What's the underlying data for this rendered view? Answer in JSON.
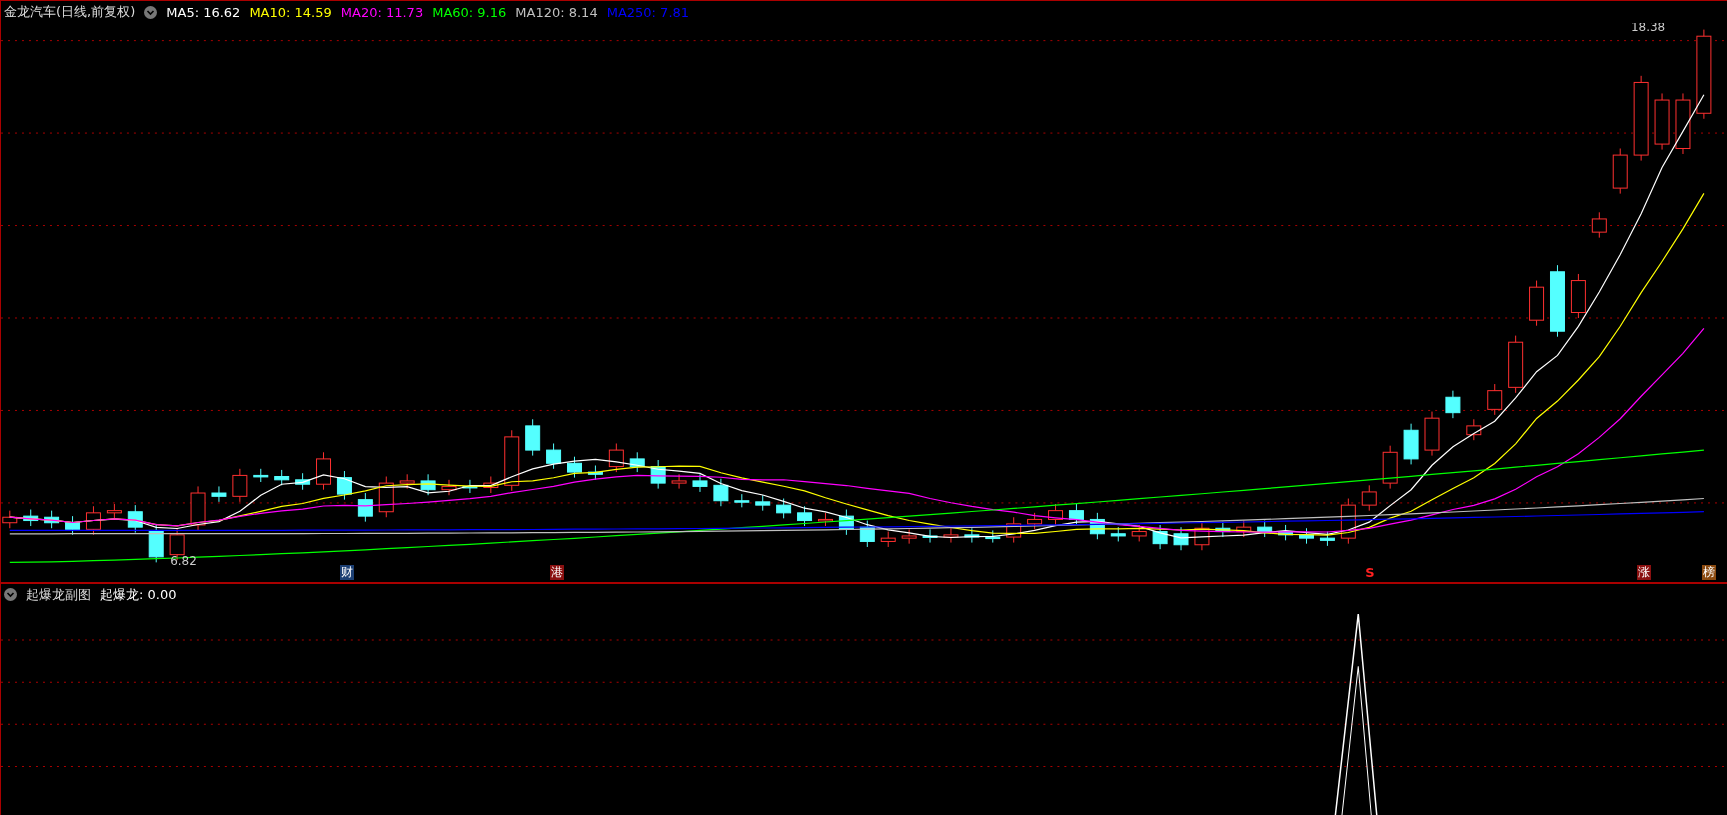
{
  "main_chart": {
    "title": "金龙汽车(日线,前复权)",
    "indicators": [
      {
        "label": "MA5: 16.62",
        "color": "#ffffff"
      },
      {
        "label": "MA10: 14.59",
        "color": "#ffff00"
      },
      {
        "label": "MA20: 11.73",
        "color": "#ff00ff"
      },
      {
        "label": "MA60: 9.16",
        "color": "#00ff00"
      },
      {
        "label": "MA120: 8.14",
        "color": "#c0c0c0"
      },
      {
        "label": "MA250: 7.81",
        "color": "#0000ff"
      }
    ],
    "high_label": "18.38",
    "low_label": "6.82",
    "markers": [
      {
        "kind": "badge",
        "text": "财",
        "color": "#1c3f73"
      },
      {
        "kind": "badge",
        "text": "港",
        "color": "#8a1010"
      },
      {
        "kind": "signal",
        "text": "S",
        "color": "#ff2020"
      },
      {
        "kind": "badge",
        "text": "涨",
        "color": "#8a1010"
      },
      {
        "kind": "badge",
        "text": "榜",
        "color": "#8a4a10"
      }
    ]
  },
  "sub_chart": {
    "title": "起爆龙副图",
    "indicators": [
      {
        "label": "起爆龙: 0.00",
        "color": "#ffffff"
      }
    ]
  }
}
